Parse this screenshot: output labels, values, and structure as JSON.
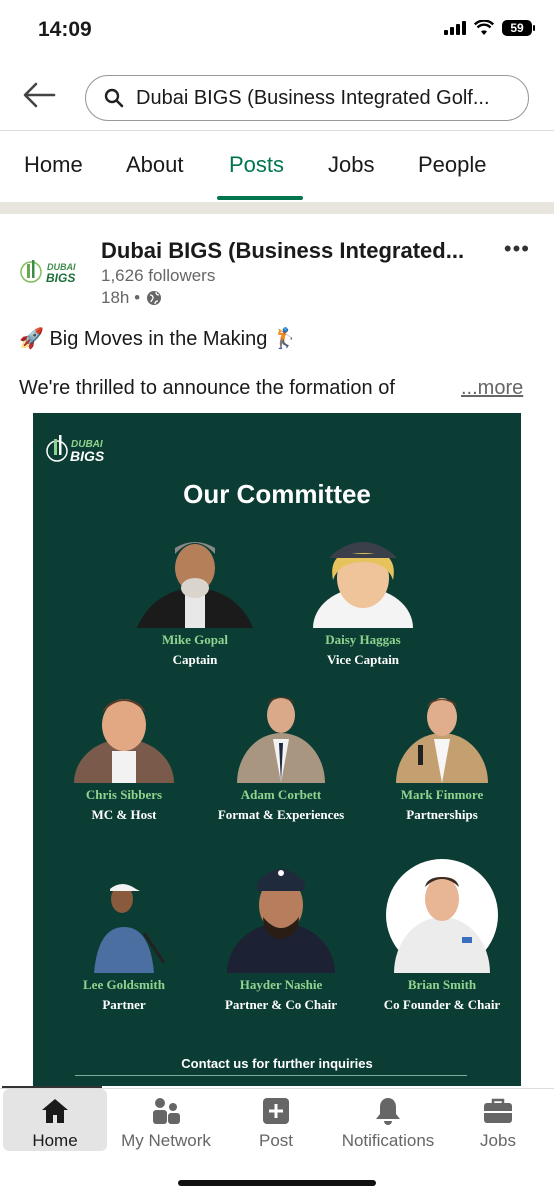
{
  "status": {
    "time": "14:09",
    "battery": "59"
  },
  "search": {
    "query": "Dubai BIGS (Business Integrated Golf..."
  },
  "tabs": [
    {
      "label": "Home"
    },
    {
      "label": "About"
    },
    {
      "label": "Posts"
    },
    {
      "label": "Jobs"
    },
    {
      "label": "People"
    }
  ],
  "active_tab": "Posts",
  "post": {
    "company": "Dubai BIGS (Business Integrated...",
    "followers": "1,626 followers",
    "time": "18h •",
    "headline": "🚀 Big Moves in the Making 🏌️",
    "body": "We're thrilled to announce the formation of",
    "more": "...more",
    "logo_text": [
      "DUBAI",
      "BIGS"
    ]
  },
  "poster": {
    "logo_text": [
      "DUBAI",
      "BIGS"
    ],
    "title": "Our Committee",
    "members": [
      {
        "name": "Mike Gopal",
        "role": "Captain"
      },
      {
        "name": "Daisy Haggas",
        "role": "Vice Captain"
      },
      {
        "name": "Chris Sibbers",
        "role": "MC & Host"
      },
      {
        "name": "Adam Corbett",
        "role": "Format & Experiences"
      },
      {
        "name": "Mark Finmore",
        "role": "Partnerships"
      },
      {
        "name": "Lee Goldsmith",
        "role": "Partner"
      },
      {
        "name": "Hayder Nashie",
        "role": "Partner & Co Chair"
      },
      {
        "name": "Brian Smith",
        "role": "Co Founder & Chair"
      }
    ],
    "contact": "Contact us for further inquiries"
  },
  "nav": [
    {
      "label": "Home",
      "icon": "home-icon"
    },
    {
      "label": "My Network",
      "icon": "network-icon"
    },
    {
      "label": "Post",
      "icon": "post-icon"
    },
    {
      "label": "Notifications",
      "icon": "bell-icon"
    },
    {
      "label": "Jobs",
      "icon": "briefcase-icon"
    }
  ],
  "colors": {
    "accent": "#01754f",
    "poster_bg": "#0c3d34",
    "member_name": "#8fd38e"
  }
}
